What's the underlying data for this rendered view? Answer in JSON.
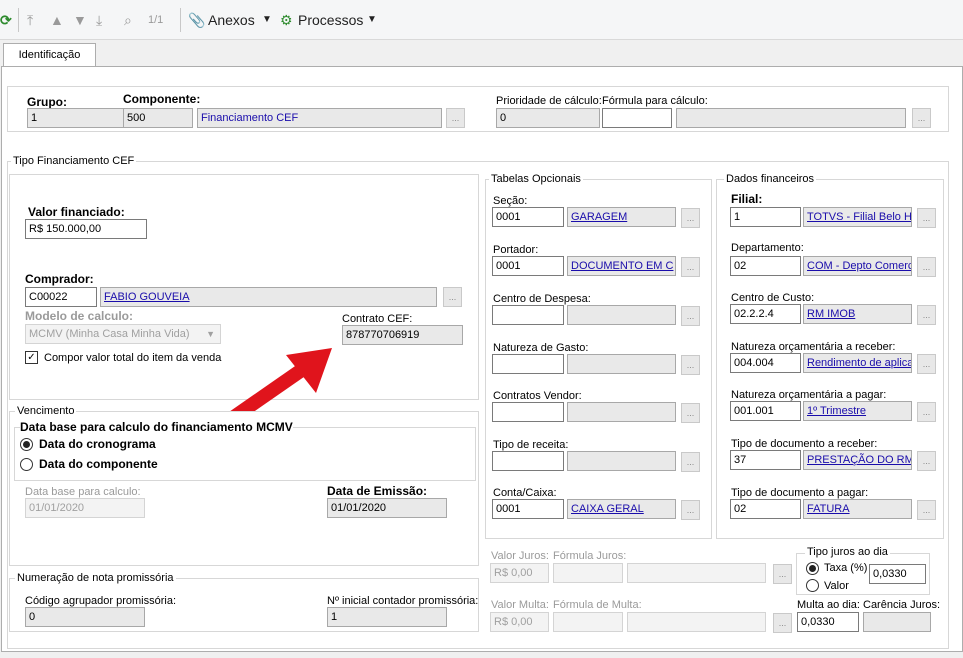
{
  "toolbar": {
    "page": "1/1",
    "annexes": "Anexos",
    "processes": "Processos"
  },
  "tabs": {
    "identificacao": "Identificação"
  },
  "header": {
    "grupo_label": "Grupo:",
    "grupo_value": "1",
    "componente_label": "Componente:",
    "componente_code": "500",
    "componente_name": "Financiamento CEF",
    "prioridade_label": "Prioridade de cálculo:",
    "prioridade_value": "0",
    "formula_label": "Fórmula para cálculo:",
    "formula_value": "",
    "formula_desc": ""
  },
  "tipo": {
    "legend": "Tipo Financiamento CEF",
    "valor_label": "Valor financiado:",
    "valor_value": "R$ 150.000,00",
    "comprador_label": "Comprador:",
    "comprador_code": "C00022",
    "comprador_name": "FABIO GOUVEIA",
    "modelo_label": "Modelo de calculo:",
    "modelo_value": "MCMV (Minha Casa Minha Vida)",
    "contrato_label": "Contrato CEF:",
    "contrato_value": "878770706919",
    "compor_label": "Compor valor total do item da venda",
    "compor_checked": true
  },
  "vencimento": {
    "legend": "Vencimento",
    "data_base_title": "Data base para calculo do financiamento MCMV",
    "opt_cronograma": "Data do cronograma",
    "opt_componente": "Data do componente",
    "data_base_calc_label": "Data base para calculo:",
    "data_base_calc_value": "01/01/2020",
    "emissao_label": "Data de Emissão:",
    "emissao_value": "01/01/2020"
  },
  "numeracao": {
    "legend": "Numeração de nota promissória",
    "codigo_label": "Código agrupador promissória:",
    "codigo_value": "0",
    "inicial_label": "Nº inicial contador promissória:",
    "inicial_value": "1"
  },
  "tabelas": {
    "legend": "Tabelas Opcionais",
    "secao_label": "Seção:",
    "secao_code": "0001",
    "secao_name": "GARAGEM",
    "portador_label": "Portador:",
    "portador_code": "0001",
    "portador_name": "DOCUMENTO EM C",
    "despesa_label": "Centro de Despesa:",
    "gasto_label": "Natureza de Gasto:",
    "vendor_label": "Contratos Vendor:",
    "receita_label": "Tipo de receita:",
    "conta_label": "Conta/Caixa:",
    "conta_code": "0001",
    "conta_name": "CAIXA GERAL"
  },
  "financeiros": {
    "legend": "Dados financeiros",
    "filial_label": "Filial:",
    "filial_code": "1",
    "filial_name": "TOTVS - Filial Belo H",
    "depto_label": "Departamento:",
    "depto_code": "02",
    "depto_name": "COM - Depto Comerc",
    "custo_label": "Centro de Custo:",
    "custo_code": "02.2.2.4",
    "custo_name": "RM IMOB",
    "nat_rec_label": "Natureza orçamentária a receber:",
    "nat_rec_code": "004.004",
    "nat_rec_name": "Rendimento de aplica",
    "nat_pag_label": "Natureza orçamentária a pagar:",
    "nat_pag_code": "001.001",
    "nat_pag_name": "1º Trimestre",
    "doc_rec_label": "Tipo de documento a receber:",
    "doc_rec_code": "37",
    "doc_rec_name": "PRESTAÇÃO DO RM",
    "doc_pag_label": "Tipo de documento a pagar:",
    "doc_pag_code": "02",
    "doc_pag_name": "FATURA"
  },
  "juros": {
    "valor_juros_label": "Valor Juros:",
    "valor_juros_value": "R$ 0,00",
    "formula_juros_label": "Fórmula Juros:",
    "valor_multa_label": "Valor Multa:",
    "valor_multa_value": "R$ 0,00",
    "formula_multa_label": "Fórmula de Multa:",
    "tipo_legend": "Tipo juros ao dia",
    "opt_taxa": "Taxa (%)",
    "opt_valor": "Valor",
    "taxa_value": "0,0330",
    "multa_dia_label": "Multa ao dia:",
    "multa_dia_value": "0,0330",
    "carencia_label": "Carência Juros:",
    "carencia_value": ""
  }
}
